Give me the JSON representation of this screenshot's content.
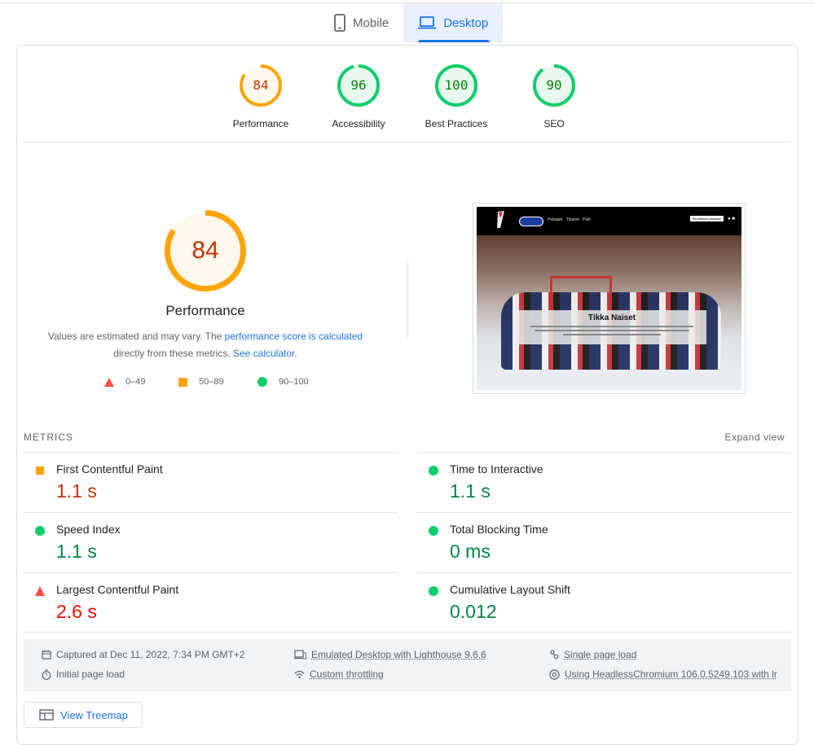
{
  "tabs": {
    "mobile": "Mobile",
    "desktop": "Desktop"
  },
  "scores": [
    {
      "label": "Performance",
      "value": "84",
      "pct": 84,
      "color": "#ffa400",
      "text_color": "#c33300",
      "fill": "#fff8ed"
    },
    {
      "label": "Accessibility",
      "value": "96",
      "pct": 96,
      "color": "#0cce6b",
      "text_color": "#008800",
      "fill": "#e8f8ef"
    },
    {
      "label": "Best Practices",
      "value": "100",
      "pct": 100,
      "color": "#0cce6b",
      "text_color": "#008800",
      "fill": "#e8f8ef"
    },
    {
      "label": "SEO",
      "value": "90",
      "pct": 90,
      "color": "#0cce6b",
      "text_color": "#008800",
      "fill": "#e8f8ef"
    }
  ],
  "main": {
    "score": "84",
    "score_pct": 84,
    "title": "Performance",
    "desc_prefix": "Values are estimated and may vary. The ",
    "desc_link": "performance score is calculated",
    "desc_mid": "directly from these metrics. ",
    "desc_link2": "See calculator",
    "desc_end": "."
  },
  "legend": {
    "poor": "0–49",
    "average": "50–89",
    "good": "90–100"
  },
  "screenshot": {
    "title": "Tikka Naiset",
    "nav": [
      "Pelaajat",
      "Tilastot",
      "Pelit"
    ],
    "cta": "Ilmoittaudu mukaan"
  },
  "metrics_section": {
    "label": "METRICS",
    "expand": "Expand view"
  },
  "metrics": [
    {
      "name": "First Contentful Paint",
      "value": "1.1 s",
      "status": "average"
    },
    {
      "name": "Time to Interactive",
      "value": "1.1 s",
      "status": "good"
    },
    {
      "name": "Speed Index",
      "value": "1.1 s",
      "status": "good"
    },
    {
      "name": "Total Blocking Time",
      "value": "0 ms",
      "status": "good"
    },
    {
      "name": "Largest Contentful Paint",
      "value": "2.6 s",
      "status": "poor"
    },
    {
      "name": "Cumulative Layout Shift",
      "value": "0.012",
      "status": "good"
    }
  ],
  "status_colors": {
    "poor": "#ff4e42",
    "average": "#ffa400",
    "good": "#0cce6b"
  },
  "value_colors": {
    "poor": "#eb0f00",
    "average": "#c33300",
    "good": "#018642"
  },
  "info": {
    "captured": "Captured at Dec 11, 2022, 7:34 PM GMT+2",
    "initial": "Initial page load",
    "emulated": "Emulated Desktop with Lighthouse 9.6.6",
    "throttling": "Custom throttling",
    "single": "Single page load",
    "browser": "Using HeadlessChromium 106.0.5249.103 with lr"
  },
  "treemap": "View Treemap"
}
